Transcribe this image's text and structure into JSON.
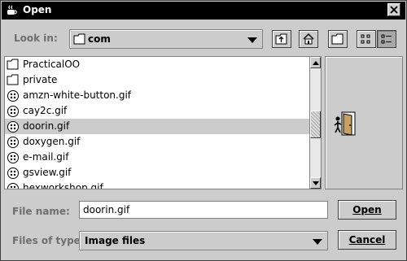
{
  "window": {
    "title": "Open"
  },
  "look_in": {
    "label": "Look in:",
    "selected": "com"
  },
  "toolbar": {
    "buttons": [
      {
        "icon": "up-folder-icon"
      },
      {
        "icon": "home-icon"
      },
      {
        "icon": "new-folder-icon"
      },
      {
        "icon": "list-view-icon"
      },
      {
        "icon": "details-view-icon"
      }
    ]
  },
  "files": [
    {
      "name": "PracticalOO",
      "type": "folder"
    },
    {
      "name": "private",
      "type": "folder"
    },
    {
      "name": "amzn-white-button.gif",
      "type": "image"
    },
    {
      "name": "cay2c.gif",
      "type": "image"
    },
    {
      "name": "doorin.gif",
      "type": "image",
      "selected": true
    },
    {
      "name": "doxygen.gif",
      "type": "image"
    },
    {
      "name": "e-mail.gif",
      "type": "image"
    },
    {
      "name": "gsview.gif",
      "type": "image"
    },
    {
      "name": "hexworkshop.gif",
      "type": "image"
    }
  ],
  "file_name": {
    "label": "File name:",
    "value": "doorin.gif"
  },
  "files_of_type": {
    "label": "Files of type:",
    "selected": "Image files"
  },
  "buttons": {
    "open": "Open",
    "cancel": "Cancel"
  },
  "colors": {
    "title_bar": "#000000",
    "dialog_bg": "#cccccc",
    "selection": "#cccccc",
    "label": "#6e6e6e"
  }
}
